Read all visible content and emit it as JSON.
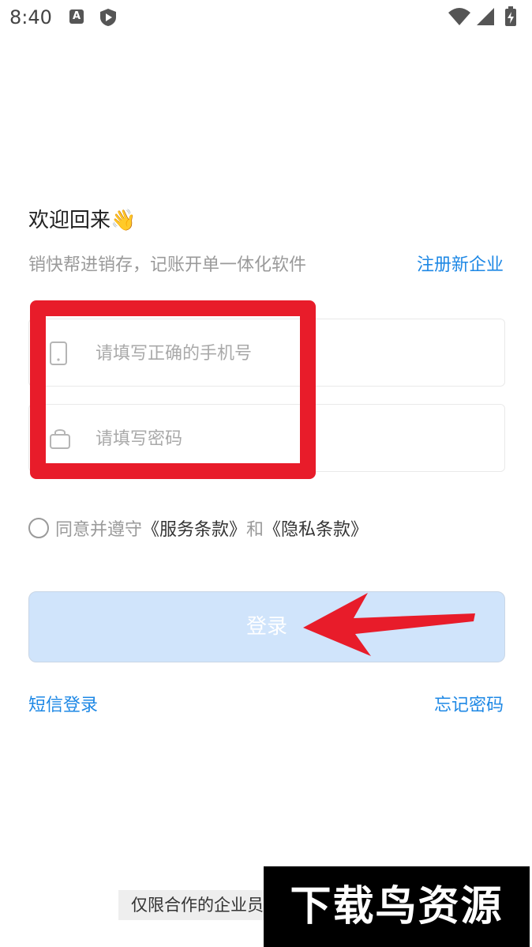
{
  "status_bar": {
    "time": "8:40",
    "notification_icon_letter": "A"
  },
  "welcome": {
    "title": "欢迎回来👋",
    "subtitle": "销快帮进销存，记账开单一体化软件",
    "register_link": "注册新企业"
  },
  "form": {
    "phone_placeholder": "请填写正确的手机号",
    "password_placeholder": "请填写密码",
    "phone_icon": "phone-icon",
    "password_icon": "lock-icon"
  },
  "agreement": {
    "prefix": "同意并遵守",
    "terms_link": "《服务条款》",
    "and": "和",
    "privacy_link": "《隐私条款》"
  },
  "buttons": {
    "login_label": "登录",
    "sms_login": "短信登录",
    "forgot_password": "忘记密码"
  },
  "footer": {
    "note": "仅限合作的企业员工"
  },
  "watermark": {
    "text": "下载鸟资源"
  },
  "colors": {
    "accent_blue": "#1e88e5",
    "annotation_red": "#e81c2a",
    "login_button_bg": "#d0e4fb"
  }
}
